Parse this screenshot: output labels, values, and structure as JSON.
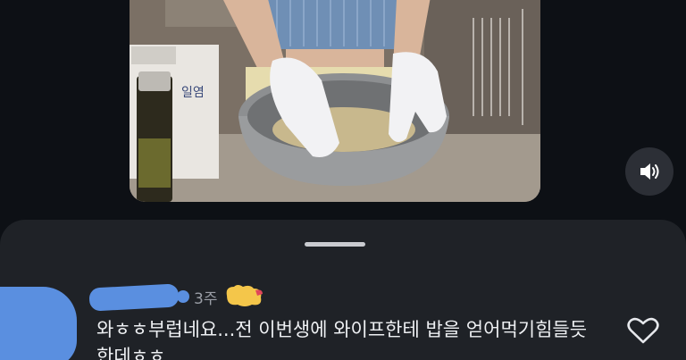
{
  "video": {
    "label_on_bag": "일염",
    "icons": {
      "volume": "volume-icon"
    }
  },
  "comment": {
    "timestamp": "3주",
    "text": "와ㅎㅎ부럽네요...전 이번생에 와이프한테 밥을 얻어먹기힘들듯한데ㅎㅎ",
    "like_count": "",
    "icons": {
      "like": "heart-outline-icon"
    }
  },
  "colors": {
    "background": "#0d1015",
    "sheet": "#1f2227",
    "redaction": "#5a8fe0",
    "sticker": "#f4c64a"
  }
}
